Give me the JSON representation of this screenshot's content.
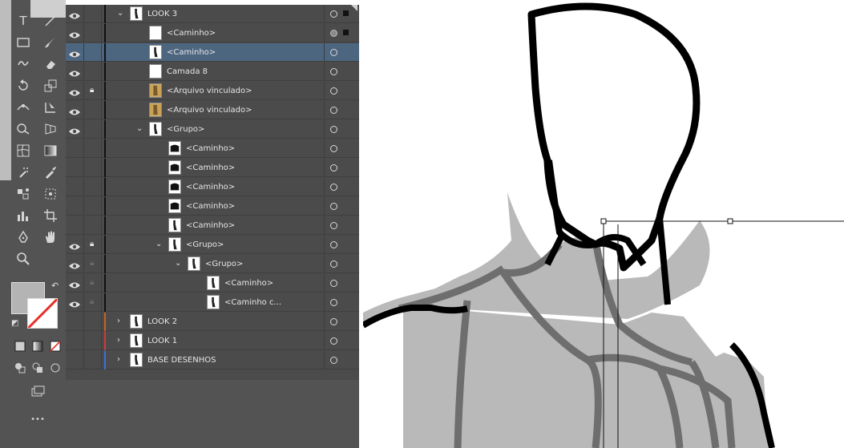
{
  "colors": {
    "selection": "#4d6680",
    "look2_layer": "#c8641e",
    "look1_layer": "#d03a3a",
    "base_layer": "#3a6fd8",
    "panel_bg": "#4b4b4b"
  },
  "toolbar": {
    "tools": [
      "type-icon",
      "line-icon",
      "rectangle-icon",
      "paintbrush-icon",
      "shaper-icon",
      "eraser-icon",
      "rotate-icon",
      "scale-icon",
      "width-icon",
      "free-transform-icon",
      "shape-builder-icon",
      "perspective-icon",
      "mesh-icon",
      "gradient-icon",
      "eyedropper-icon",
      "eyedropper-alt-icon",
      "symbol-sprayer-icon",
      "blend-icon",
      "column-graph-icon",
      "artboard-icon",
      "pen-icon",
      "hand-icon",
      "zoom-icon"
    ],
    "more_label": "•••"
  },
  "layers": [
    {
      "label": "LOOK 3",
      "lock": "",
      "expand": "open",
      "visible": true,
      "thumb": "figure",
      "indent": 0
    },
    {
      "label": "<Caminho>",
      "lock": "",
      "expand": "",
      "visible": true,
      "thumb": "blank",
      "indent": 1
    },
    {
      "label": "<Caminho>",
      "lock": "",
      "expand": "",
      "visible": true,
      "thumb": "figure",
      "indent": 1,
      "selected": true
    },
    {
      "label": "Camada 8",
      "lock": "",
      "expand": "",
      "visible": true,
      "thumb": "blank",
      "indent": 1
    },
    {
      "label": "<Arquivo vinculado>",
      "lock": "locked",
      "expand": "",
      "visible": true,
      "thumb": "photo",
      "indent": 1
    },
    {
      "label": "<Arquivo vinculado>",
      "lock": "",
      "expand": "",
      "visible": true,
      "thumb": "photo",
      "indent": 1
    },
    {
      "label": "<Grupo>",
      "lock": "",
      "expand": "open",
      "visible": true,
      "thumb": "figure",
      "indent": 1
    },
    {
      "label": "<Caminho>",
      "lock": "",
      "expand": "",
      "visible": false,
      "thumb": "dark",
      "indent": 2
    },
    {
      "label": "<Caminho>",
      "lock": "",
      "expand": "",
      "visible": false,
      "thumb": "dark",
      "indent": 2
    },
    {
      "label": "<Caminho>",
      "lock": "",
      "expand": "",
      "visible": false,
      "thumb": "dark",
      "indent": 2
    },
    {
      "label": "<Caminho>",
      "lock": "",
      "expand": "",
      "visible": false,
      "thumb": "dark",
      "indent": 2
    },
    {
      "label": "<Caminho>",
      "lock": "",
      "expand": "",
      "visible": false,
      "thumb": "figure",
      "indent": 2
    },
    {
      "label": "<Grupo>",
      "lock": "locked",
      "expand": "open",
      "visible": true,
      "thumb": "figure",
      "indent": 2
    },
    {
      "label": "<Grupo>",
      "lock": "dim",
      "expand": "open",
      "visible": true,
      "thumb": "figure",
      "indent": 3
    },
    {
      "label": "<Caminho>",
      "lock": "dim",
      "expand": "",
      "visible": true,
      "thumb": "figure",
      "indent": 4
    },
    {
      "label": "<Caminho c...",
      "lock": "dim",
      "expand": "",
      "visible": true,
      "thumb": "figure",
      "indent": 4
    },
    {
      "label": "LOOK 2",
      "lock": "",
      "expand": "closed",
      "visible": false,
      "thumb": "figure",
      "indent": 0,
      "color": "#c8641e"
    },
    {
      "label": "LOOK 1",
      "lock": "",
      "expand": "closed",
      "visible": false,
      "thumb": "figure",
      "indent": 0,
      "color": "#d03a3a"
    },
    {
      "label": "BASE DESENHOS",
      "lock": "",
      "expand": "closed",
      "visible": false,
      "thumb": "figure",
      "indent": 0,
      "color": "#3a6fd8"
    }
  ]
}
